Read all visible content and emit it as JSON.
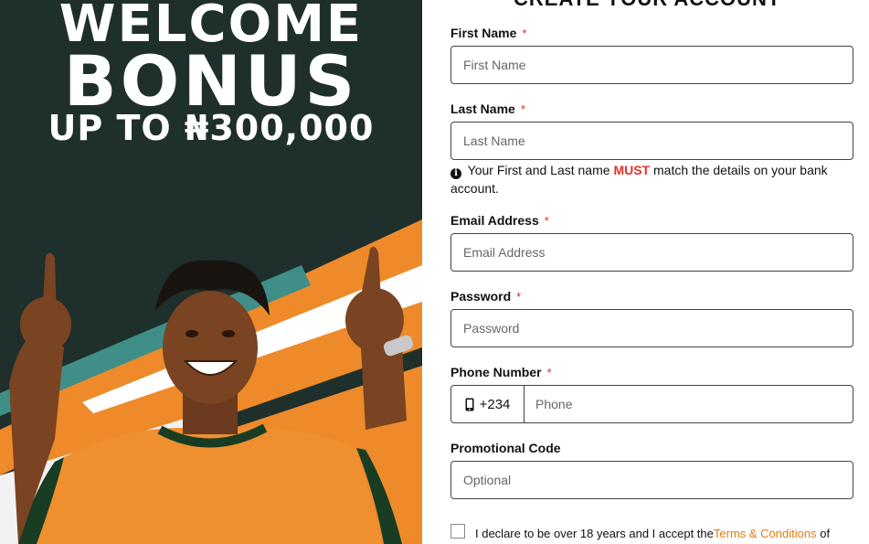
{
  "promo": {
    "line1": "WELCOME",
    "line2": "BONUS",
    "line3": "UP TO ₦300,000",
    "colors": {
      "background": "#1e2f2c",
      "accent": "#ee8a2a",
      "teal": "#3f8f88"
    }
  },
  "form": {
    "title": "CREATE YOUR ACCOUNT",
    "required_mark": "*",
    "first_name": {
      "label": "First Name",
      "placeholder": "First Name"
    },
    "last_name": {
      "label": "Last Name",
      "placeholder": "Last Name"
    },
    "name_note": {
      "before": "Your First and Last name",
      "emphasis": "MUST",
      "after": "match the details on your bank account."
    },
    "email": {
      "label": "Email Address",
      "placeholder": "Email Address"
    },
    "password": {
      "label": "Password",
      "placeholder": "Password"
    },
    "phone": {
      "label": "Phone Number",
      "prefix": "+234",
      "placeholder": "Phone"
    },
    "promo_code": {
      "label": "Promotional Code",
      "placeholder": "Optional"
    },
    "consent": {
      "text": "I declare to be over 18 years and I accept the",
      "link": "Terms & Conditions",
      "after": "of"
    },
    "colors": {
      "required": "#d0312d",
      "must": "#e5302a",
      "link": "#e27d10"
    }
  }
}
